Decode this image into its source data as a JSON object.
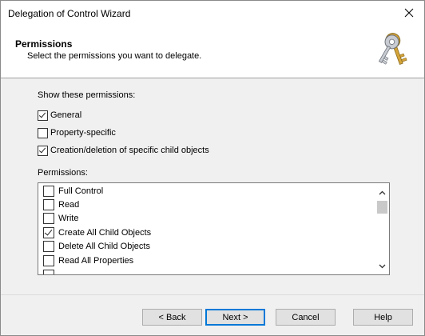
{
  "window": {
    "title": "Delegation of Control Wizard",
    "close_glyph": "✕"
  },
  "header": {
    "title": "Permissions",
    "subtitle": "Select the permissions you want to delegate.",
    "icon": "keys-icon"
  },
  "show_section": {
    "label": "Show these permissions:",
    "options": [
      {
        "label": "General",
        "checked": true
      },
      {
        "label": "Property-specific",
        "checked": false
      },
      {
        "label": "Creation/deletion of specific child objects",
        "checked": true
      }
    ]
  },
  "permissions": {
    "label": "Permissions:",
    "items": [
      {
        "label": "Full Control",
        "checked": false
      },
      {
        "label": "Read",
        "checked": false
      },
      {
        "label": "Write",
        "checked": false
      },
      {
        "label": "Create All Child Objects",
        "checked": true
      },
      {
        "label": "Delete All Child Objects",
        "checked": false
      },
      {
        "label": "Read All Properties",
        "checked": false
      }
    ]
  },
  "buttons": {
    "back": "< Back",
    "next": "Next >",
    "cancel": "Cancel",
    "help": "Help"
  }
}
